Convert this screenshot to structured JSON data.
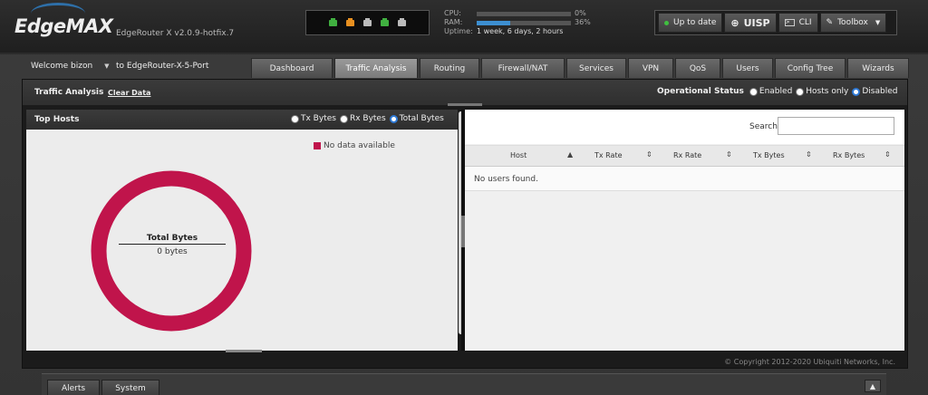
{
  "header": {
    "brand": "EdgeMAX",
    "device_version": "EdgeRouter X v2.0.9-hotfix.7",
    "ports": [
      "#40b040",
      "#e89020",
      "#bbbbbb",
      "#40b040",
      "#bbbbbb"
    ],
    "stats": {
      "cpu_label": "CPU:",
      "cpu_pct": "0%",
      "cpu_value": 0,
      "ram_label": "RAM:",
      "ram_pct": "36%",
      "ram_value": 36,
      "uptime_label": "Uptime:",
      "uptime_value": "1 week, 6 days, 2 hours"
    },
    "tools": {
      "up_to_date": "Up to date",
      "uisp": "UISP",
      "cli": "CLI",
      "toolbox": "Toolbox"
    }
  },
  "nav": {
    "welcome": "Welcome bizon",
    "device_link": "to EdgeRouter-X-5-Port",
    "tabs": [
      "Dashboard",
      "Traffic Analysis",
      "Routing",
      "Firewall/NAT",
      "Services",
      "VPN",
      "QoS",
      "Users",
      "Config Tree",
      "Wizards"
    ],
    "active_tab": "Traffic Analysis"
  },
  "panel": {
    "title": "Traffic Analysis",
    "clear_data": "Clear Data",
    "op_status_label": "Operational Status",
    "op_options": [
      "Enabled",
      "Hosts only",
      "Disabled"
    ],
    "op_selected": "Disabled"
  },
  "top_hosts": {
    "title": "Top Hosts",
    "options": [
      "Tx Bytes",
      "Rx Bytes",
      "Total Bytes"
    ],
    "selected": "Total Bytes",
    "legend": "No data available",
    "legend_color": "#c0144b",
    "center_title": "Total Bytes",
    "center_value": "0 bytes"
  },
  "hosts_table": {
    "search_label": "Search",
    "search_value": "",
    "columns": [
      "Host",
      "Tx Rate",
      "Rx Rate",
      "Tx Bytes",
      "Rx Bytes"
    ],
    "empty_text": "No users found."
  },
  "footer": {
    "copyright": "© Copyright 2012-2020 Ubiquiti Networks, Inc.",
    "tabs": [
      "Alerts",
      "System"
    ]
  }
}
